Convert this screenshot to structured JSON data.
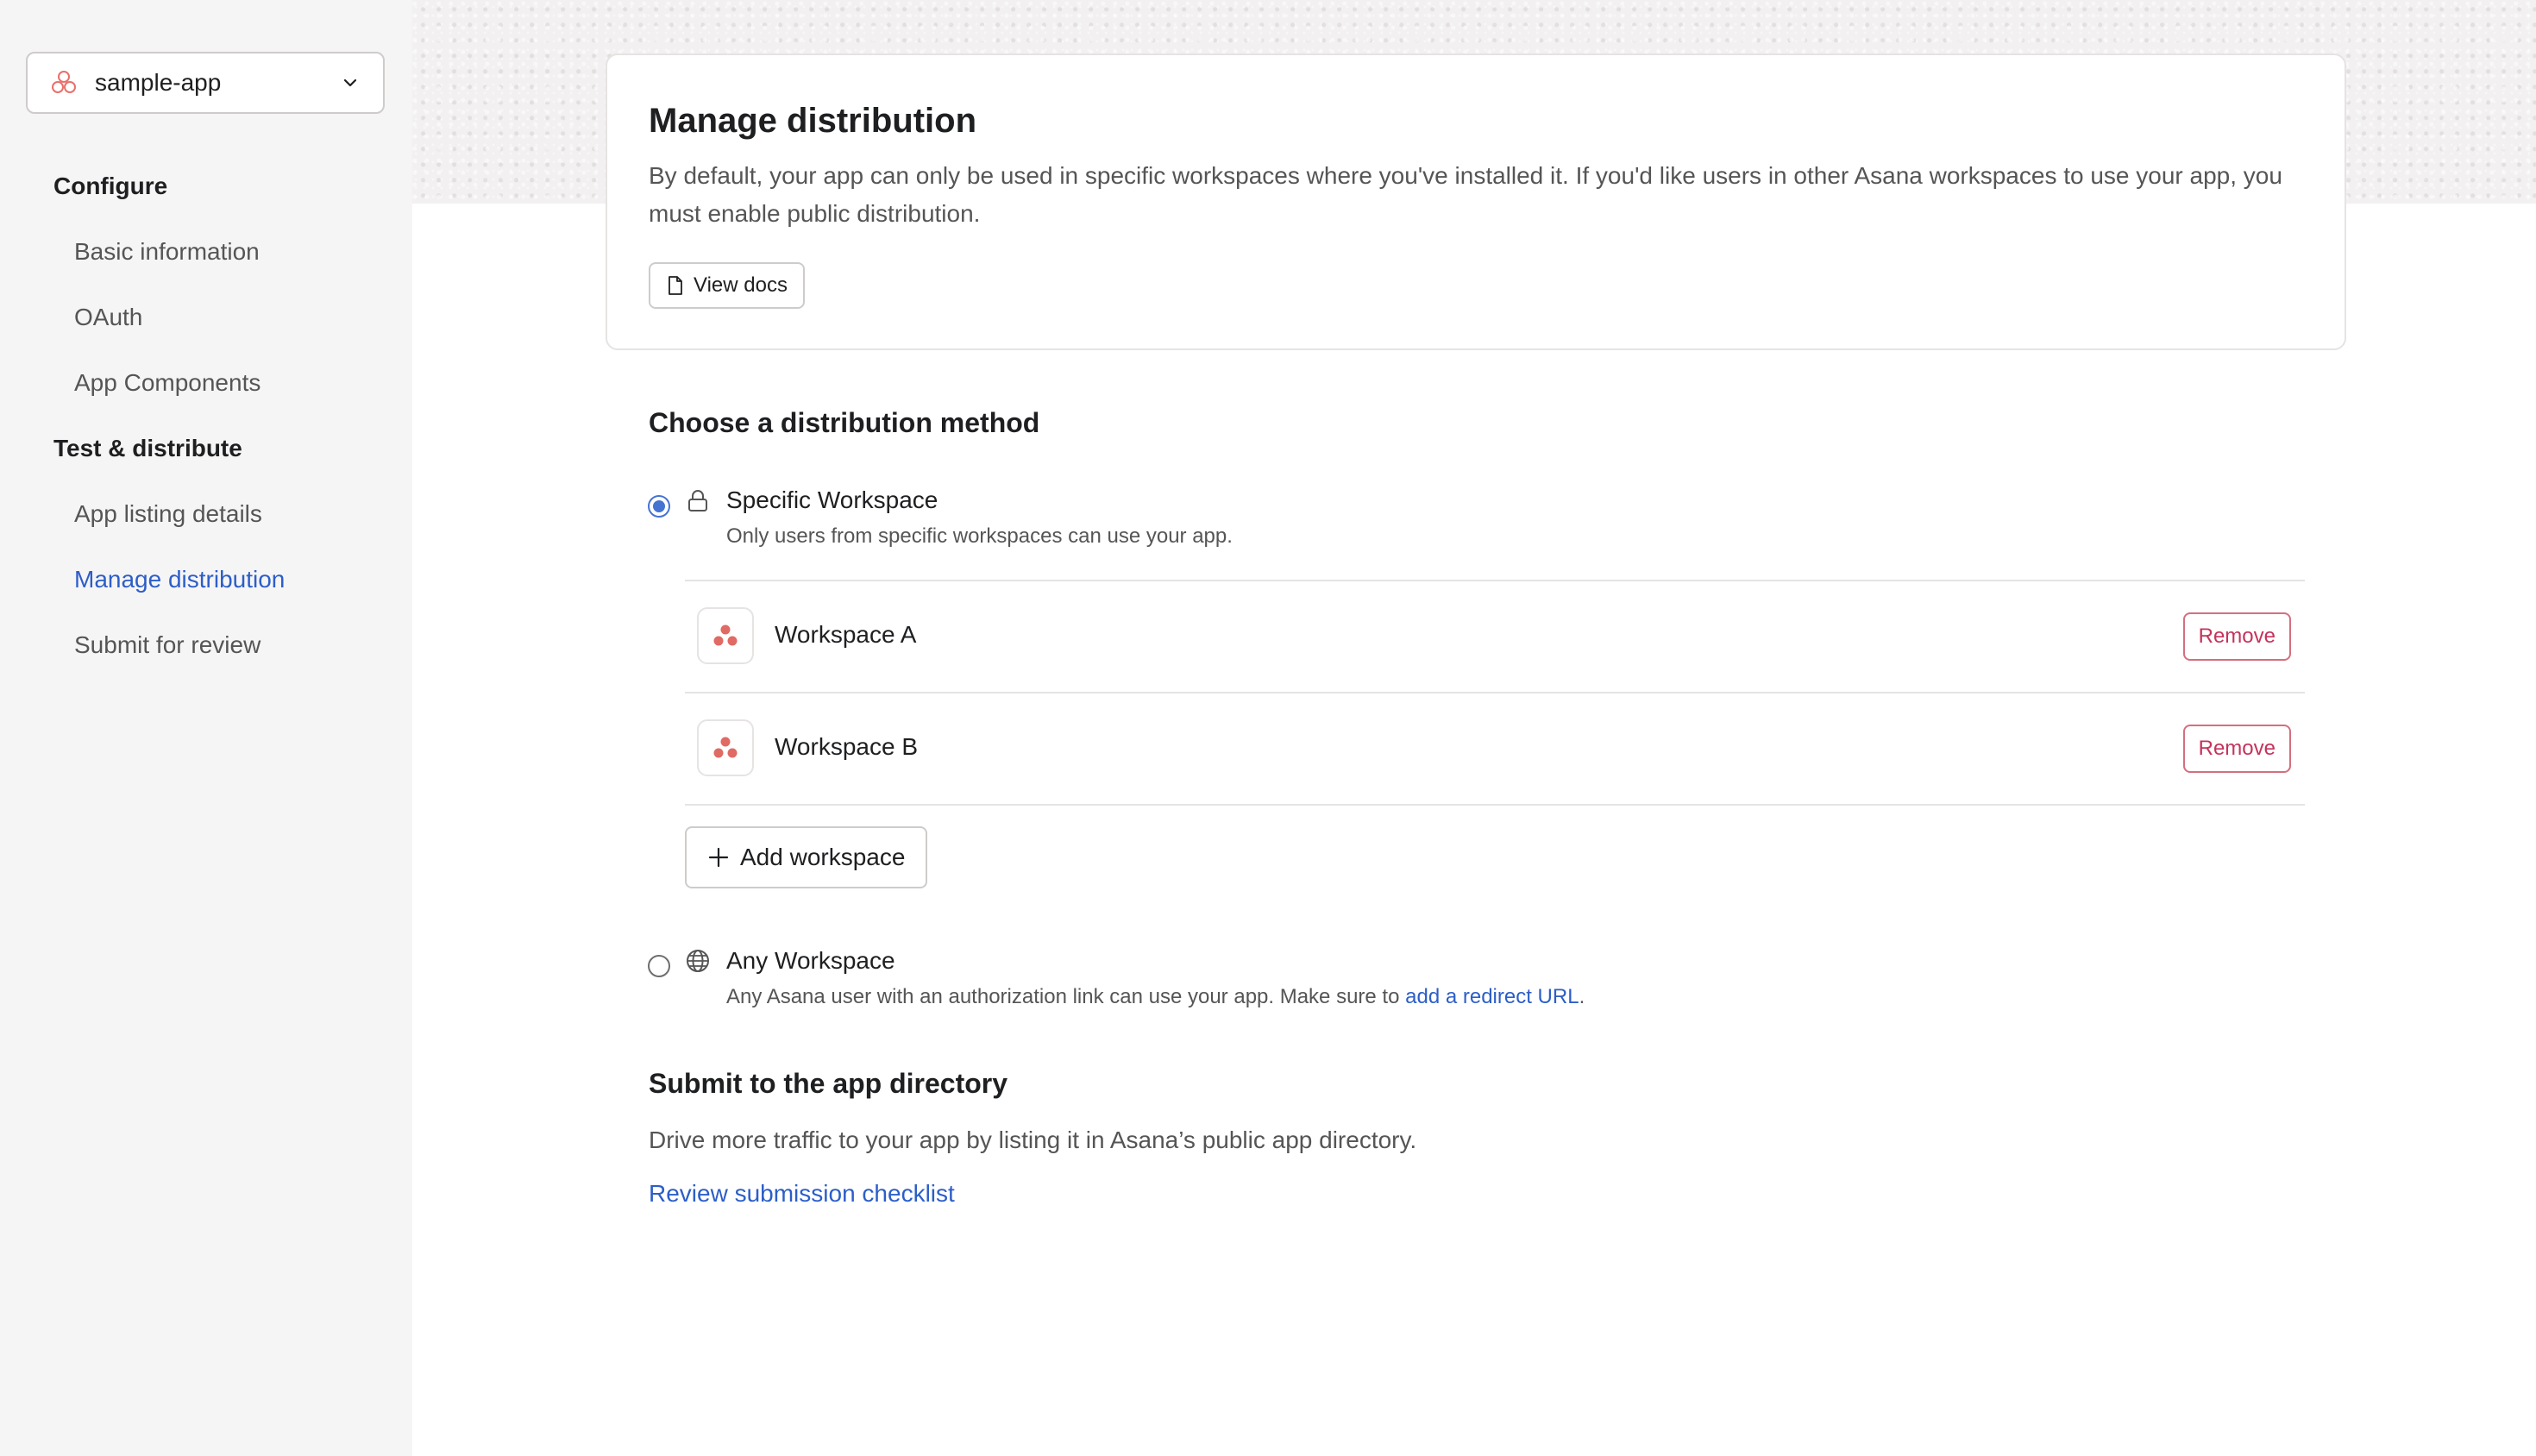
{
  "sidebar": {
    "app_name": "sample-app",
    "sections": [
      {
        "title": "Configure",
        "items": [
          "Basic information",
          "OAuth",
          "App Components"
        ]
      },
      {
        "title": "Test & distribute",
        "items": [
          "App listing details",
          "Manage distribution",
          "Submit for review"
        ]
      }
    ],
    "active_item": "Manage distribution"
  },
  "header_card": {
    "title": "Manage distribution",
    "description": "By default, your app can only be used in specific workspaces where you've installed it. If you'd like users in other Asana workspaces to use your app, you must enable public distribution.",
    "view_docs_label": "View docs"
  },
  "distribution": {
    "heading": "Choose a distribution method",
    "specific": {
      "title": "Specific Workspace",
      "subtitle": "Only users from specific workspaces can use your app.",
      "selected": true
    },
    "workspaces": [
      {
        "name": "Workspace A",
        "remove_label": "Remove"
      },
      {
        "name": "Workspace B",
        "remove_label": "Remove"
      }
    ],
    "add_workspace_label": "Add workspace",
    "any": {
      "title": "Any Workspace",
      "subtitle_prefix": "Any Asana user with an authorization link can use your app. Make sure to ",
      "subtitle_link": "add a redirect URL",
      "subtitle_suffix": ".",
      "selected": false
    }
  },
  "directory": {
    "heading": "Submit to the app directory",
    "text": "Drive more traffic to your app by listing it in Asana’s public app directory.",
    "link": "Review submission checklist"
  },
  "colors": {
    "accent": "#4573d2",
    "link": "#2c5ec8",
    "danger": "#c6325b",
    "asana_coral": "#e8706a"
  }
}
